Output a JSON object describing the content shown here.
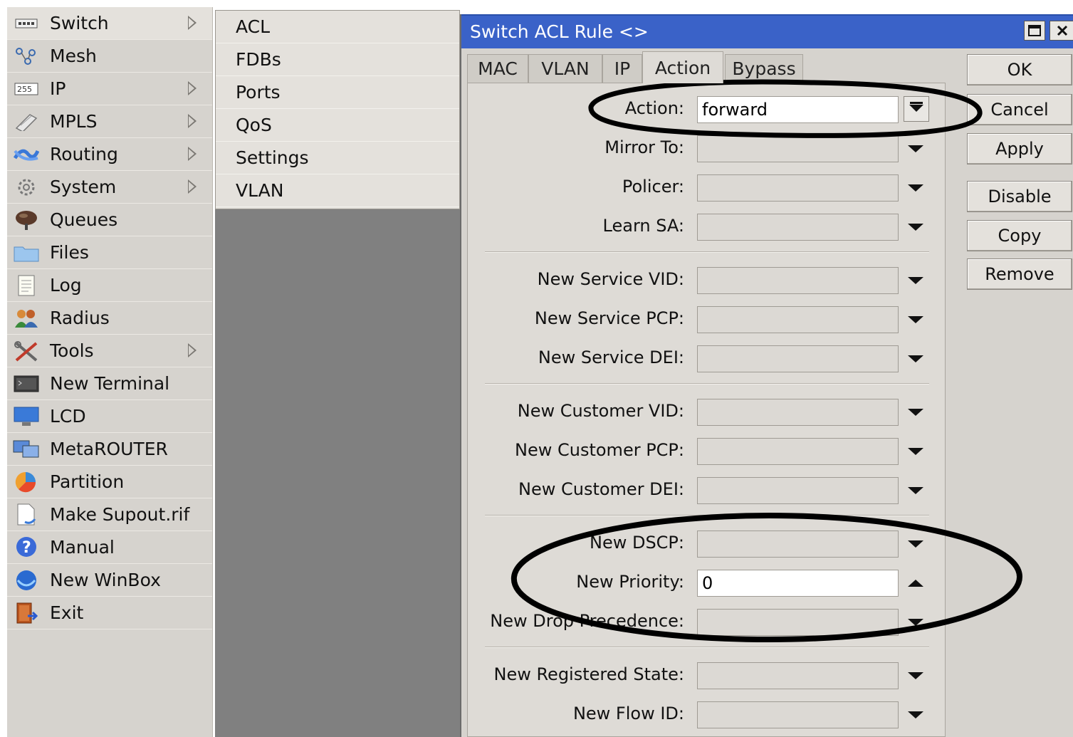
{
  "main_menu": {
    "items": [
      {
        "label": "Switch",
        "icon": "switch-icon",
        "submenu": true
      },
      {
        "label": "Mesh",
        "icon": "mesh-icon",
        "submenu": false
      },
      {
        "label": "IP",
        "icon": "ip-icon",
        "submenu": true
      },
      {
        "label": "MPLS",
        "icon": "mpls-icon",
        "submenu": true
      },
      {
        "label": "Routing",
        "icon": "routing-icon",
        "submenu": true
      },
      {
        "label": "System",
        "icon": "system-icon",
        "submenu": true
      },
      {
        "label": "Queues",
        "icon": "queues-icon",
        "submenu": false
      },
      {
        "label": "Files",
        "icon": "files-icon",
        "submenu": false
      },
      {
        "label": "Log",
        "icon": "log-icon",
        "submenu": false
      },
      {
        "label": "Radius",
        "icon": "radius-icon",
        "submenu": false
      },
      {
        "label": "Tools",
        "icon": "tools-icon",
        "submenu": true
      },
      {
        "label": "New Terminal",
        "icon": "terminal-icon",
        "submenu": false
      },
      {
        "label": "LCD",
        "icon": "lcd-icon",
        "submenu": false
      },
      {
        "label": "MetaROUTER",
        "icon": "metarouter-icon",
        "submenu": false
      },
      {
        "label": "Partition",
        "icon": "partition-icon",
        "submenu": false
      },
      {
        "label": "Make Supout.rif",
        "icon": "supout-icon",
        "submenu": false
      },
      {
        "label": "Manual",
        "icon": "manual-icon",
        "submenu": false
      },
      {
        "label": "New WinBox",
        "icon": "winbox-icon",
        "submenu": false
      },
      {
        "label": "Exit",
        "icon": "exit-icon",
        "submenu": false
      }
    ]
  },
  "submenu": {
    "items": [
      "ACL",
      "FDBs",
      "Ports",
      "QoS",
      "Settings",
      "VLAN"
    ]
  },
  "dialog": {
    "title": "Switch ACL Rule <>",
    "tabs": [
      "MAC",
      "VLAN",
      "IP",
      "Action",
      "Bypass"
    ],
    "active_tab": "Action",
    "fields": {
      "action": {
        "label": "Action:",
        "value": "forward"
      },
      "mirror_to": {
        "label": "Mirror To:",
        "value": ""
      },
      "policer": {
        "label": "Policer:",
        "value": ""
      },
      "learn_sa": {
        "label": "Learn SA:",
        "value": ""
      },
      "new_service_vid": {
        "label": "New Service VID:",
        "value": ""
      },
      "new_service_pcp": {
        "label": "New Service PCP:",
        "value": ""
      },
      "new_service_dei": {
        "label": "New Service DEI:",
        "value": ""
      },
      "new_customer_vid": {
        "label": "New Customer VID:",
        "value": ""
      },
      "new_customer_pcp": {
        "label": "New Customer PCP:",
        "value": ""
      },
      "new_customer_dei": {
        "label": "New Customer DEI:",
        "value": ""
      },
      "new_dscp": {
        "label": "New DSCP:",
        "value": ""
      },
      "new_priority": {
        "label": "New Priority:",
        "value": "0"
      },
      "new_drop_precedence": {
        "label": "New Drop Precedence:",
        "value": ""
      },
      "new_registered_state": {
        "label": "New Registered State:",
        "value": ""
      },
      "new_flow_id": {
        "label": "New Flow ID:",
        "value": ""
      }
    },
    "buttons": {
      "ok": "OK",
      "cancel": "Cancel",
      "apply": "Apply",
      "disable": "Disable",
      "copy": "Copy",
      "remove": "Remove"
    }
  },
  "colors": {
    "titlebar": "#3a62c8",
    "menu_background": "#d6d3ce",
    "annotation_ellipse": "#000000"
  }
}
